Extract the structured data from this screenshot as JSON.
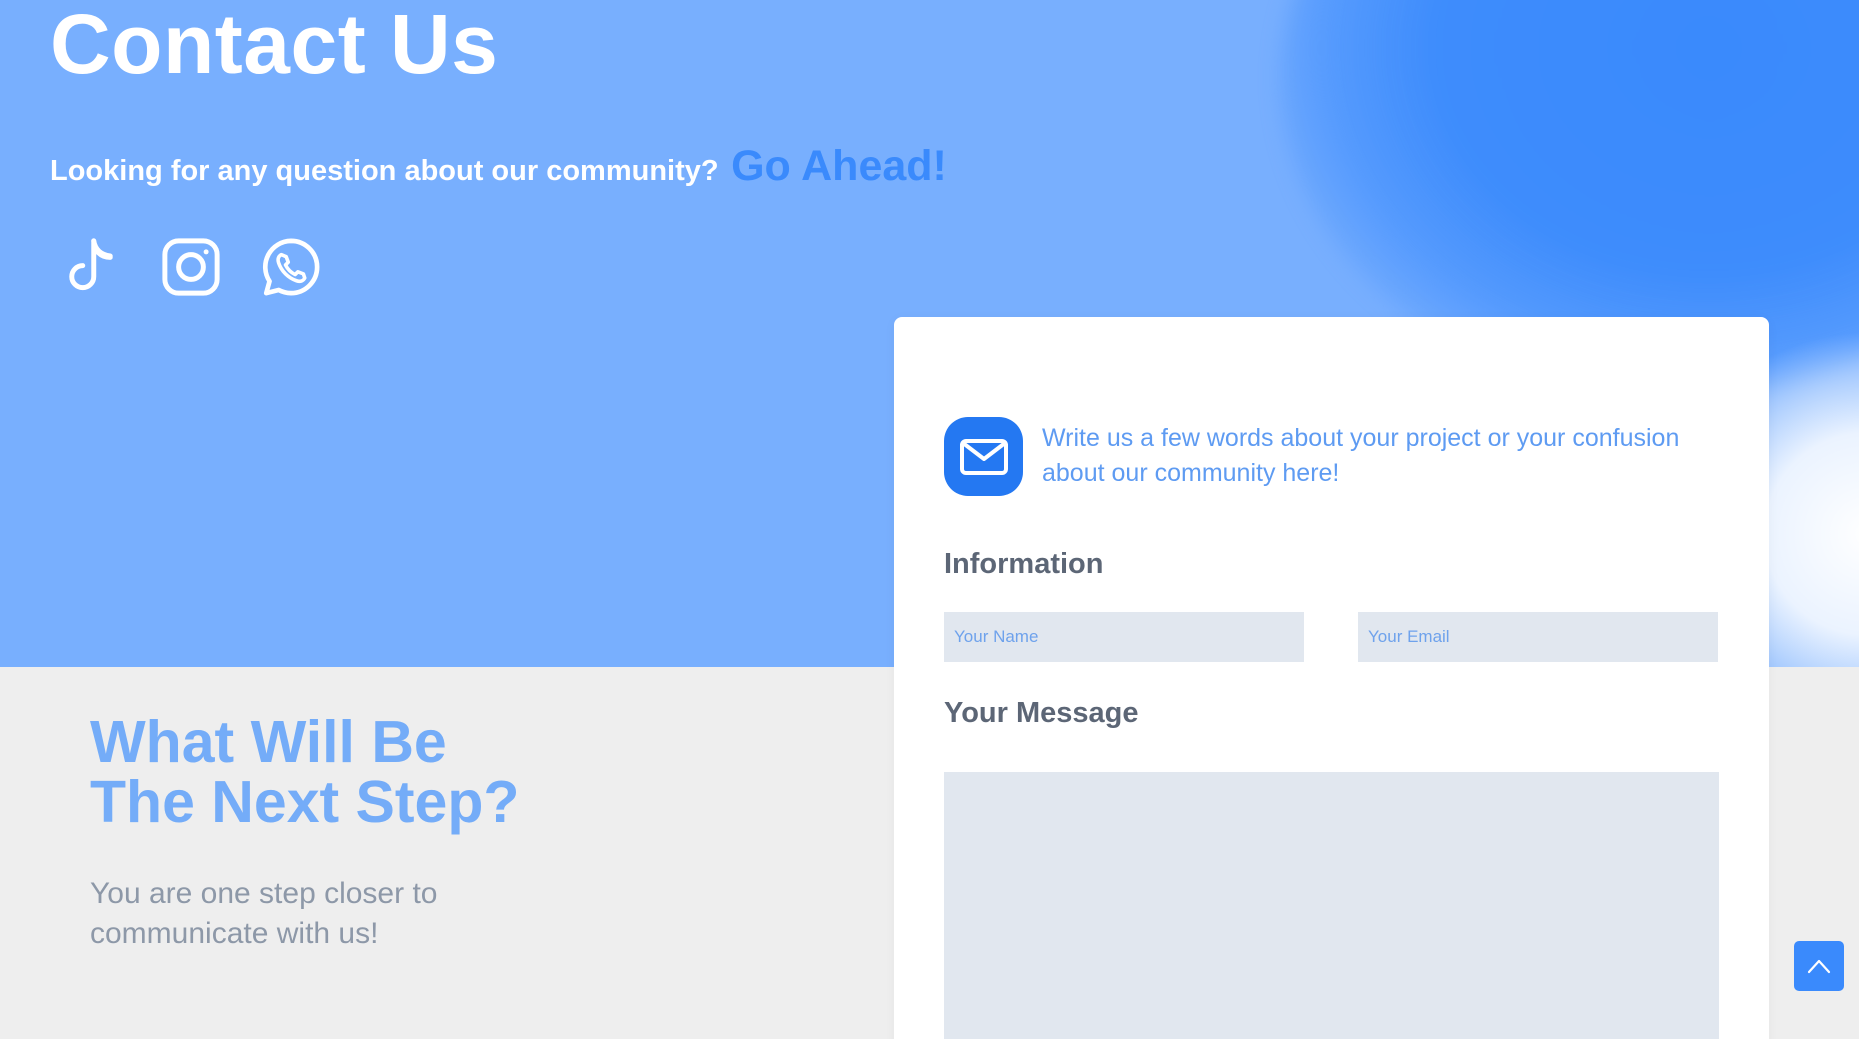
{
  "hero": {
    "title": "Contact Us",
    "subtitle": "Looking for any question about our community?",
    "subtitle_accent": "Go Ahead!",
    "socials": [
      {
        "icon": "tiktok-icon"
      },
      {
        "icon": "instagram-icon"
      },
      {
        "icon": "whatsapp-icon"
      }
    ]
  },
  "next_step": {
    "title_line1": "What Will Be",
    "title_line2": "The Next Step?",
    "text_line1": "You are one step closer to",
    "text_line2": "communicate with us!"
  },
  "form": {
    "icon": "mail-icon",
    "intro": "Write us a few words about your project or your confusion about our community here!",
    "information_label": "Information",
    "name_placeholder": "Your Name",
    "email_placeholder": "Your Email",
    "message_label": "Your Message",
    "message_value": ""
  },
  "scroll_top": {
    "icon": "chevron-up-icon"
  },
  "colors": {
    "hero_bg": "#78affe",
    "accent": "#3a8afc",
    "mail_badge": "#2478f2",
    "heading_blue": "#74acf8",
    "label_gray": "#5c6676",
    "input_bg": "#e1e7ef",
    "page_bg": "#eeeeee"
  }
}
